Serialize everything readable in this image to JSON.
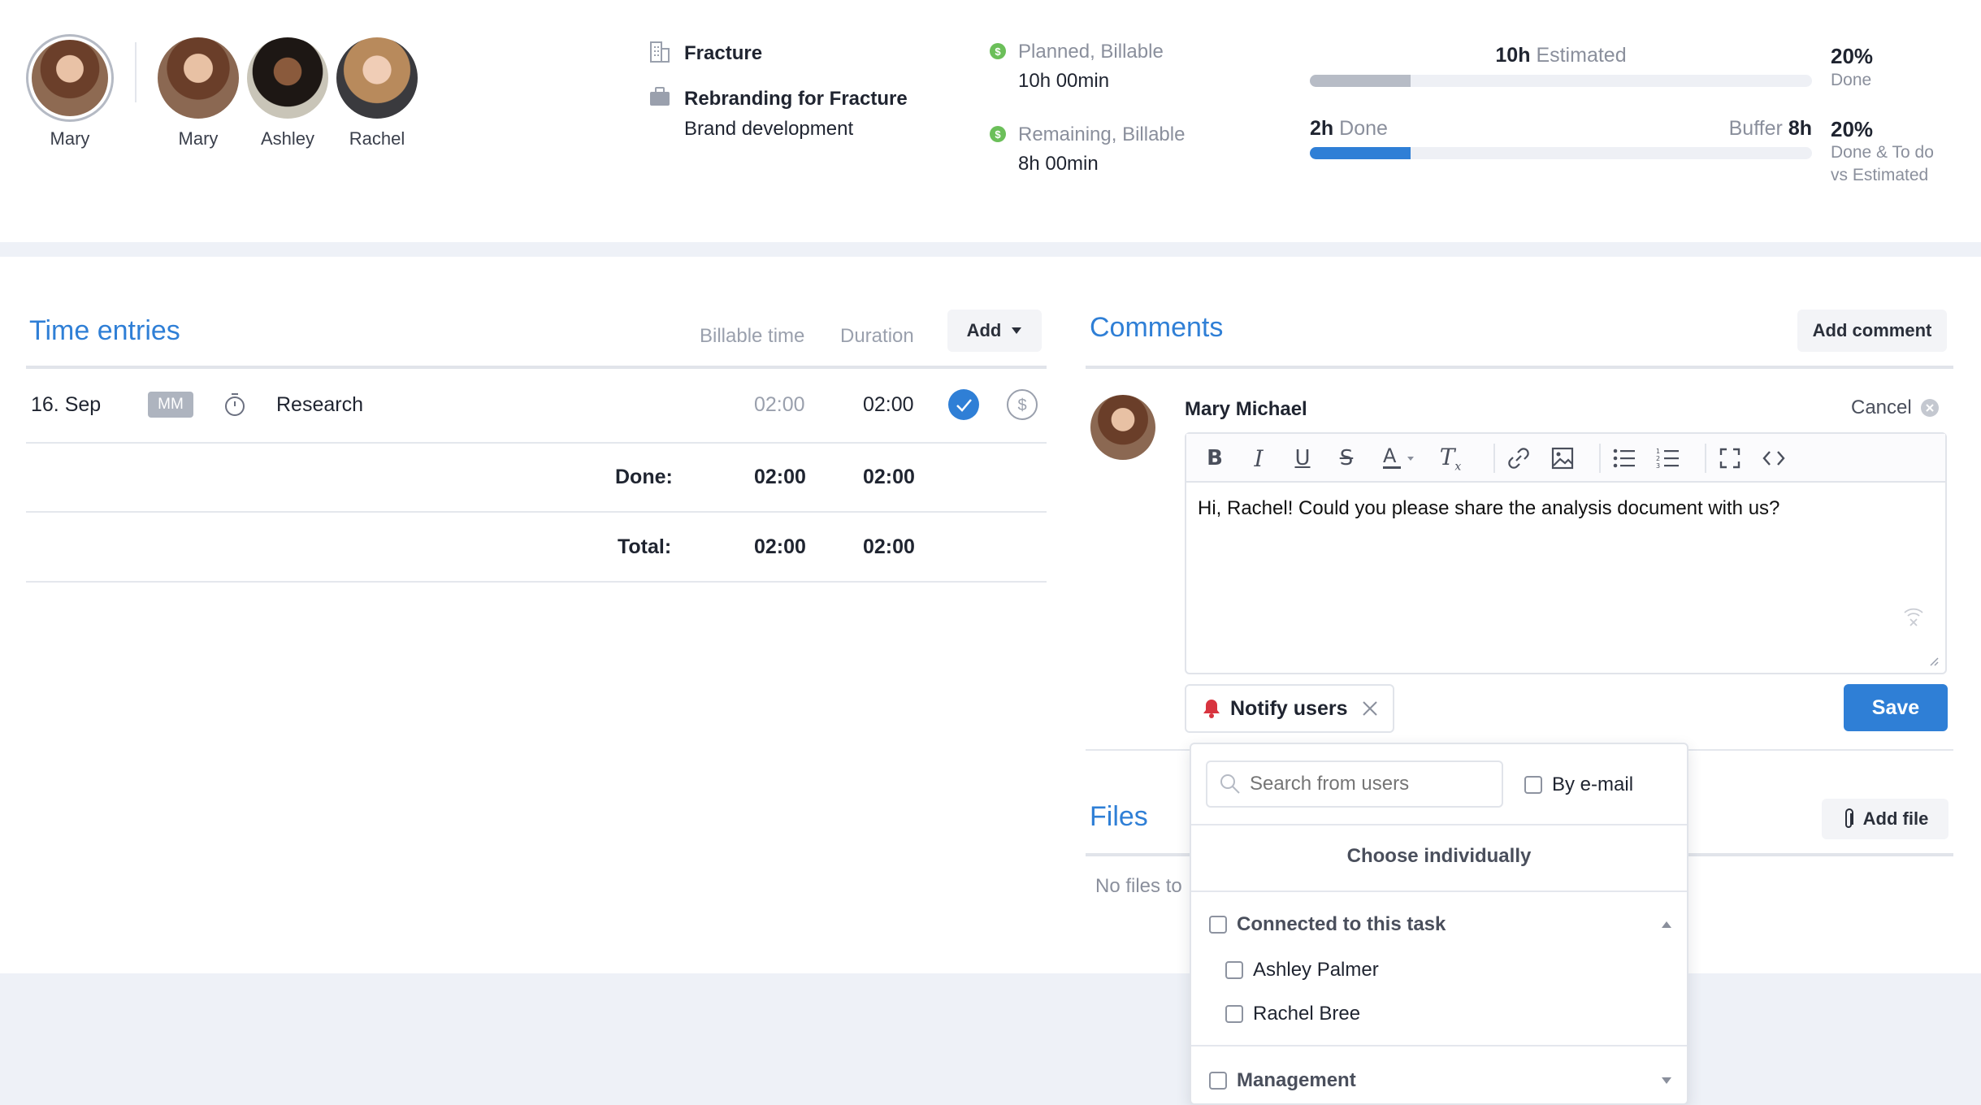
{
  "header": {
    "assignees": [
      {
        "name": "Mary"
      },
      {
        "name": "Mary"
      },
      {
        "name": "Ashley"
      },
      {
        "name": "Rachel"
      }
    ],
    "client": "Fracture",
    "project": "Rebranding for Fracture",
    "service": "Brand development",
    "planned_label": "Planned, Billable",
    "planned_value": "10h 00min",
    "remaining_label": "Remaining, Billable",
    "remaining_value": "8h 00min",
    "estimated_value": "10h",
    "estimated_label": "Estimated",
    "done_value": "2h",
    "done_label": "Done",
    "buffer_label": "Buffer",
    "buffer_value": "8h",
    "done_pct": "20%",
    "done_pct_label": "Done",
    "done_todo_pct": "20%",
    "done_todo_label_1": "Done & To do",
    "done_todo_label_2": "vs Estimated",
    "estimated_bar_fraction": 0.2,
    "done_bar_fraction": 0.2
  },
  "time_entries": {
    "title": "Time entries",
    "col_billable": "Billable time",
    "col_duration": "Duration",
    "add_label": "Add",
    "rows": [
      {
        "date": "16. Sep",
        "user_initials": "MM",
        "task": "Research",
        "billable": "02:00",
        "duration": "02:00"
      }
    ],
    "done_label": "Done:",
    "done_billable": "02:00",
    "done_duration": "02:00",
    "total_label": "Total:",
    "total_billable": "02:00",
    "total_duration": "02:00"
  },
  "comments": {
    "title": "Comments",
    "add_label": "Add comment",
    "author": "Mary Michael",
    "cancel_label": "Cancel",
    "editor_text": "Hi, Rachel! Could you please share the analysis document with us?",
    "notify_label": "Notify users",
    "save_label": "Save"
  },
  "files": {
    "title": "Files",
    "add_label": "Add file",
    "empty_text": "No files to"
  },
  "notify_dropdown": {
    "search_placeholder": "Search from users",
    "by_email_label": "By e-mail",
    "choose_label": "Choose individually",
    "groups": [
      {
        "label": "Connected to this task",
        "users": [
          "Ashley Palmer",
          "Rachel Bree"
        ]
      },
      {
        "label": "Management"
      }
    ]
  },
  "colors": {
    "accent": "#2f7fd6",
    "estimated_bar": "#b7bcc6",
    "done_bar": "#2f7fd6",
    "billable_dot": "#6bbf59",
    "bell": "#d8343f"
  }
}
